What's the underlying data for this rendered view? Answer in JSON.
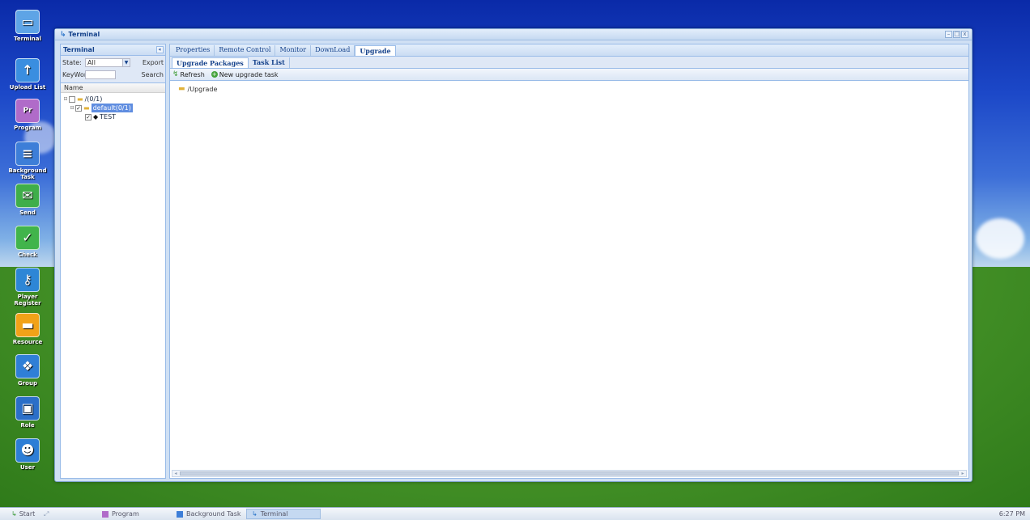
{
  "desktop": {
    "icons": [
      {
        "label": "Terminal",
        "icon": "monitor-icon",
        "color": "#5ea4e6"
      },
      {
        "label": "Upload List",
        "icon": "upload-arrow-icon",
        "color": "#3a8ee0"
      },
      {
        "label": "Program",
        "icon": "program-icon",
        "color": "#b06bc9",
        "glyph": "Pr"
      },
      {
        "label": "Background Task",
        "icon": "list-icon",
        "color": "#3d7ed8"
      },
      {
        "label": "Send",
        "icon": "send-icon",
        "color": "#3fae4a"
      },
      {
        "label": "Check",
        "icon": "check-icon",
        "color": "#41b44b"
      },
      {
        "label": "Player Register",
        "icon": "key-icon",
        "color": "#2d86d6"
      },
      {
        "label": "Resource",
        "icon": "folder-icon",
        "color": "#f2a218"
      },
      {
        "label": "Group",
        "icon": "group-icon",
        "color": "#2f7fd6"
      },
      {
        "label": "Role",
        "icon": "role-icon",
        "color": "#2b6fc8"
      },
      {
        "label": "User",
        "icon": "user-icon",
        "color": "#2d7ed6"
      }
    ]
  },
  "window": {
    "title": "Terminal",
    "controls": [
      "–",
      "□",
      "x"
    ]
  },
  "left_panel": {
    "title": "Terminal",
    "collapse_symbol": "«",
    "state_label": "State:",
    "state_value": "All",
    "export_label": "Export",
    "keyword_label": "KeyWord",
    "keyword_value": "",
    "search_label": "Search",
    "column_header": "Name",
    "tree": [
      {
        "label": "/(0/1)",
        "level": 0,
        "checked": false
      },
      {
        "label": "default(0/1)",
        "level": 1,
        "checked": true,
        "selected": true
      },
      {
        "label": "TEST",
        "level": 2,
        "checked": true
      }
    ]
  },
  "right_panel": {
    "tabs": [
      "Properties",
      "Remote Control",
      "Monitor",
      "DownLoad",
      "Upgrade"
    ],
    "active_tab": "Upgrade",
    "subtabs": [
      "Upgrade Packages",
      "Task List"
    ],
    "active_subtab": "Upgrade Packages",
    "toolbar": {
      "refresh_label": "Refresh",
      "new_task_label": "New upgrade task"
    },
    "root_folder": "/Upgrade"
  },
  "taskbar": {
    "start_label": "Start",
    "tasks": [
      {
        "label": "Program",
        "color": "#b06bc9",
        "active": false
      },
      {
        "label": "Background Task",
        "color": "#3d7ed8",
        "active": false
      },
      {
        "label": "Terminal",
        "color": "#2a74c9",
        "active": true
      }
    ],
    "clock": "6:27 PM"
  }
}
